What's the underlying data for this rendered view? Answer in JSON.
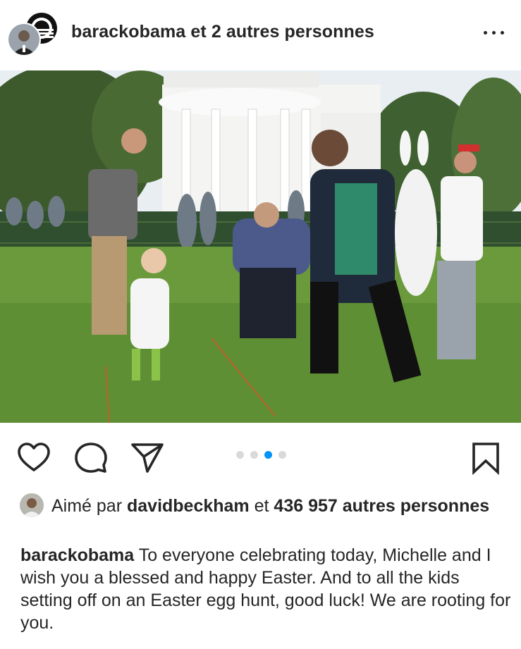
{
  "header": {
    "username": "barackobama",
    "coauthors_text": " et 2 autres personnes",
    "more_icon": "more-horizontal-icon"
  },
  "post": {
    "carousel": {
      "count": 4,
      "active_index": 2
    }
  },
  "actions": {
    "like_icon": "heart-icon",
    "comment_icon": "comment-icon",
    "share_icon": "send-icon",
    "save_icon": "bookmark-icon"
  },
  "likes": {
    "prefix": "Aimé par ",
    "liked_by": "davidbeckham",
    "middle": " et ",
    "count_text": "436 957 autres personnes"
  },
  "caption": {
    "username": "barackobama",
    "text": " To everyone celebrating today, Michelle and I wish you a blessed and happy Easter. And to all the kids setting off on an Easter egg hunt, good luck! We are rooting for you."
  },
  "colors": {
    "text": "#262626",
    "accent": "#0095f6",
    "dot_inactive": "#d9d9d9"
  }
}
